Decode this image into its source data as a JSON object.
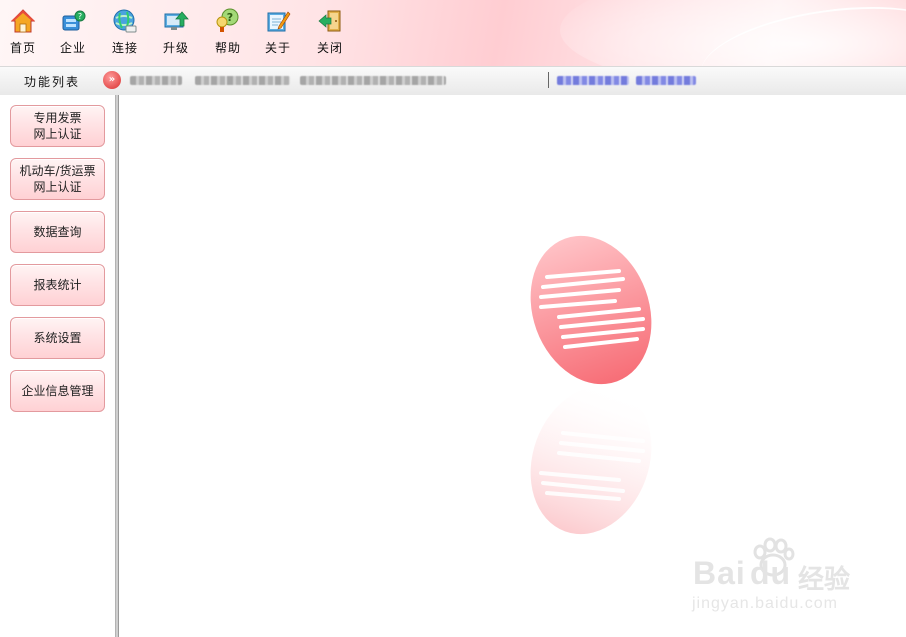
{
  "toolbar": {
    "items": [
      {
        "label": "首页",
        "icon": "home-icon"
      },
      {
        "label": "企业",
        "icon": "enterprise-icon"
      },
      {
        "label": "连接",
        "icon": "connect-icon"
      },
      {
        "label": "升级",
        "icon": "upgrade-icon"
      },
      {
        "label": "帮助",
        "icon": "help-icon"
      },
      {
        "label": "关于",
        "icon": "about-icon"
      },
      {
        "label": "关闭",
        "icon": "close-icon"
      }
    ]
  },
  "function_bar": {
    "title": "功能列表"
  },
  "sidebar": {
    "buttons": [
      {
        "line1": "专用发票",
        "line2": "网上认证"
      },
      {
        "line1": "机动车/货运票",
        "line2": "网上认证"
      },
      {
        "line1": "数据查询",
        "line2": ""
      },
      {
        "line1": "报表统计",
        "line2": ""
      },
      {
        "line1": "系统设置",
        "line2": ""
      },
      {
        "line1": "企业信息管理",
        "line2": ""
      }
    ]
  },
  "watermark": {
    "brand": "Bai",
    "brand_cn": "经验",
    "url": "jingyan.baidu.com"
  },
  "colors": {
    "accent": "#ff7f86",
    "toolbar_bg": "#ffe4e6",
    "button_border": "#e39a9e"
  }
}
